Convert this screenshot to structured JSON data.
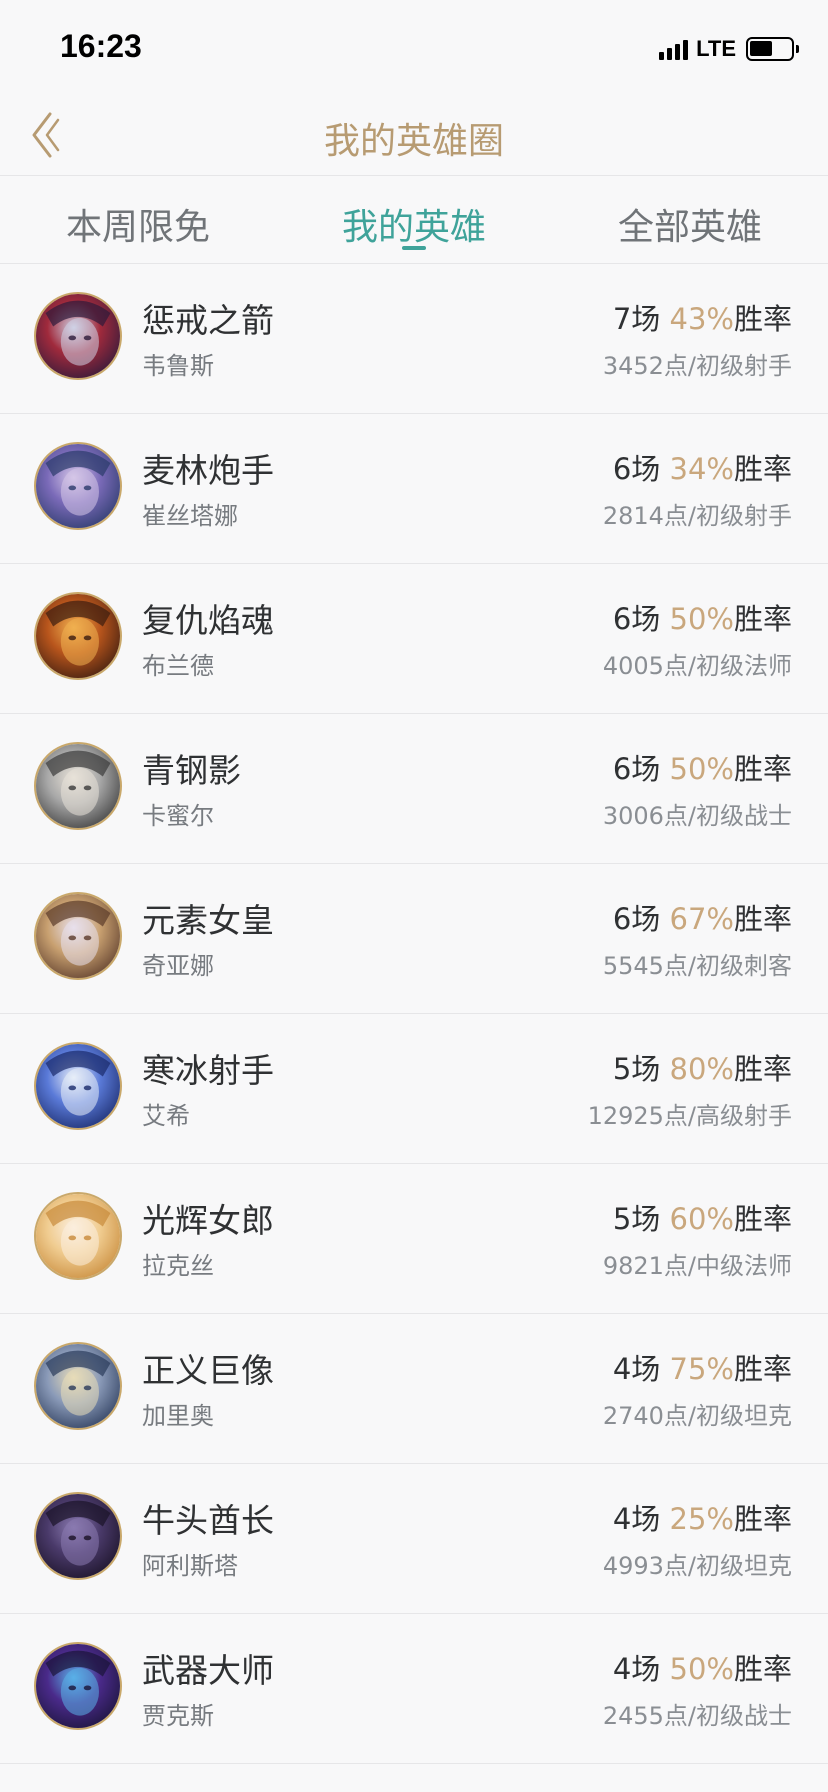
{
  "status_bar": {
    "time": "16:23",
    "network": "LTE"
  },
  "nav": {
    "title": "我的英雄圈"
  },
  "tabs": [
    {
      "label": "本周限免",
      "active": false
    },
    {
      "label": "我的英雄",
      "active": true
    },
    {
      "label": "全部英雄",
      "active": false
    }
  ],
  "labels": {
    "games_unit": "场",
    "win_rate_suffix": "胜率"
  },
  "heroes": [
    {
      "title": "惩戒之箭",
      "name": "韦鲁斯",
      "games": "7",
      "win_rate": "43%",
      "points": "3452点/初级射手",
      "colors": [
        "#2c1a3a",
        "#a02a3c",
        "#cfd2e6"
      ]
    },
    {
      "title": "麦林炮手",
      "name": "崔丝塔娜",
      "games": "6",
      "win_rate": "34%",
      "points": "2814点/初级射手",
      "colors": [
        "#2a3a6a",
        "#7a6ab8",
        "#d6c7e8"
      ]
    },
    {
      "title": "复仇焰魂",
      "name": "布兰德",
      "games": "6",
      "win_rate": "50%",
      "points": "4005点/初级法师",
      "colors": [
        "#3a1c10",
        "#b8551c",
        "#f0b050"
      ]
    },
    {
      "title": "青钢影",
      "name": "卡蜜尔",
      "games": "6",
      "win_rate": "50%",
      "points": "3006点/初级战士",
      "colors": [
        "#3a3a3a",
        "#a8a8a8",
        "#e8e2d8"
      ]
    },
    {
      "title": "元素女皇",
      "name": "奇亚娜",
      "games": "6",
      "win_rate": "67%",
      "points": "5545点/初级刺客",
      "colors": [
        "#5a3a2a",
        "#c8a070",
        "#e8e0ec"
      ]
    },
    {
      "title": "寒冰射手",
      "name": "艾希",
      "games": "5",
      "win_rate": "80%",
      "points": "12925点/高级射手",
      "colors": [
        "#1a2a6a",
        "#5a7ad8",
        "#e8eef8"
      ]
    },
    {
      "title": "光辉女郎",
      "name": "拉克丝",
      "games": "5",
      "win_rate": "60%",
      "points": "9821点/中级法师",
      "colors": [
        "#c88a3a",
        "#f0cc90",
        "#fbeede"
      ]
    },
    {
      "title": "正义巨像",
      "name": "加里奥",
      "games": "4",
      "win_rate": "75%",
      "points": "2740点/初级坦克",
      "colors": [
        "#2a3a5a",
        "#8a9ab8",
        "#e8dcb8"
      ]
    },
    {
      "title": "牛头酋长",
      "name": "阿利斯塔",
      "games": "4",
      "win_rate": "25%",
      "points": "4993点/初级坦克",
      "colors": [
        "#1a1226",
        "#4a3a6a",
        "#8a7ab0"
      ]
    },
    {
      "title": "武器大师",
      "name": "贾克斯",
      "games": "4",
      "win_rate": "50%",
      "points": "2455点/初级战士",
      "colors": [
        "#1a1438",
        "#4a2a8a",
        "#5ab0e8"
      ]
    }
  ]
}
